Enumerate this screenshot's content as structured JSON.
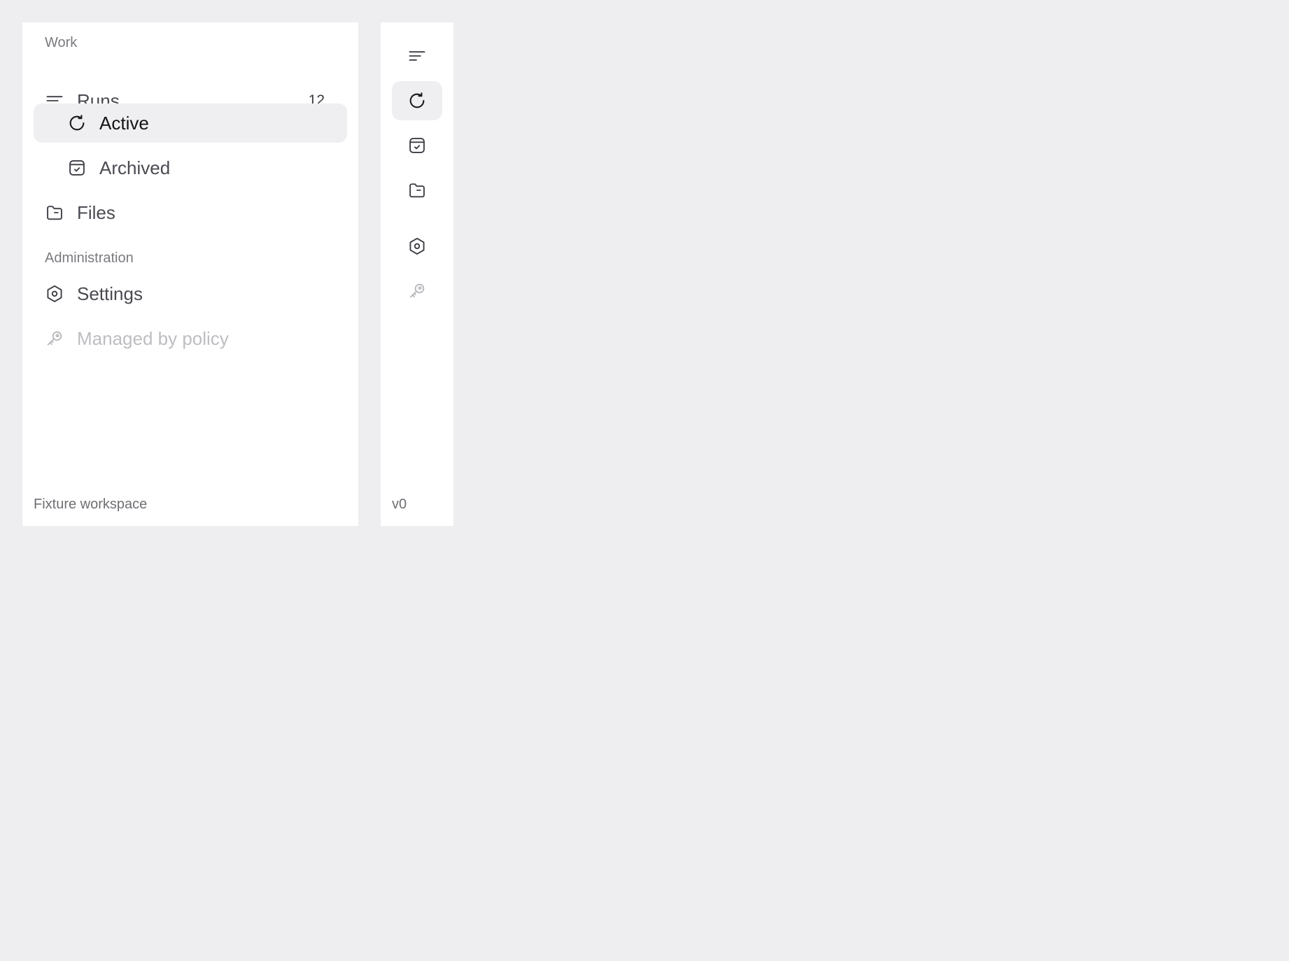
{
  "sidebar": {
    "sections": [
      {
        "label": "Work"
      },
      {
        "label": "Administration"
      }
    ],
    "items": [
      {
        "label": "Runs",
        "count": "12",
        "icon": "list-filter-icon"
      },
      {
        "label": "Active",
        "icon": "refresh-icon",
        "selected": true
      },
      {
        "label": "Archived",
        "icon": "archive-check-icon"
      },
      {
        "label": "Files",
        "icon": "folder-icon"
      },
      {
        "label": "Settings",
        "icon": "hexagon-settings-icon"
      },
      {
        "label": "Managed by policy",
        "icon": "key-icon",
        "disabled": true
      }
    ],
    "footer": "Fixture workspace"
  },
  "rail": {
    "footer": "v0"
  },
  "colors": {
    "background": "#eeeef0",
    "panel": "#ffffff",
    "selected": "#efeff1",
    "muted_text": "#bdbdc2"
  }
}
